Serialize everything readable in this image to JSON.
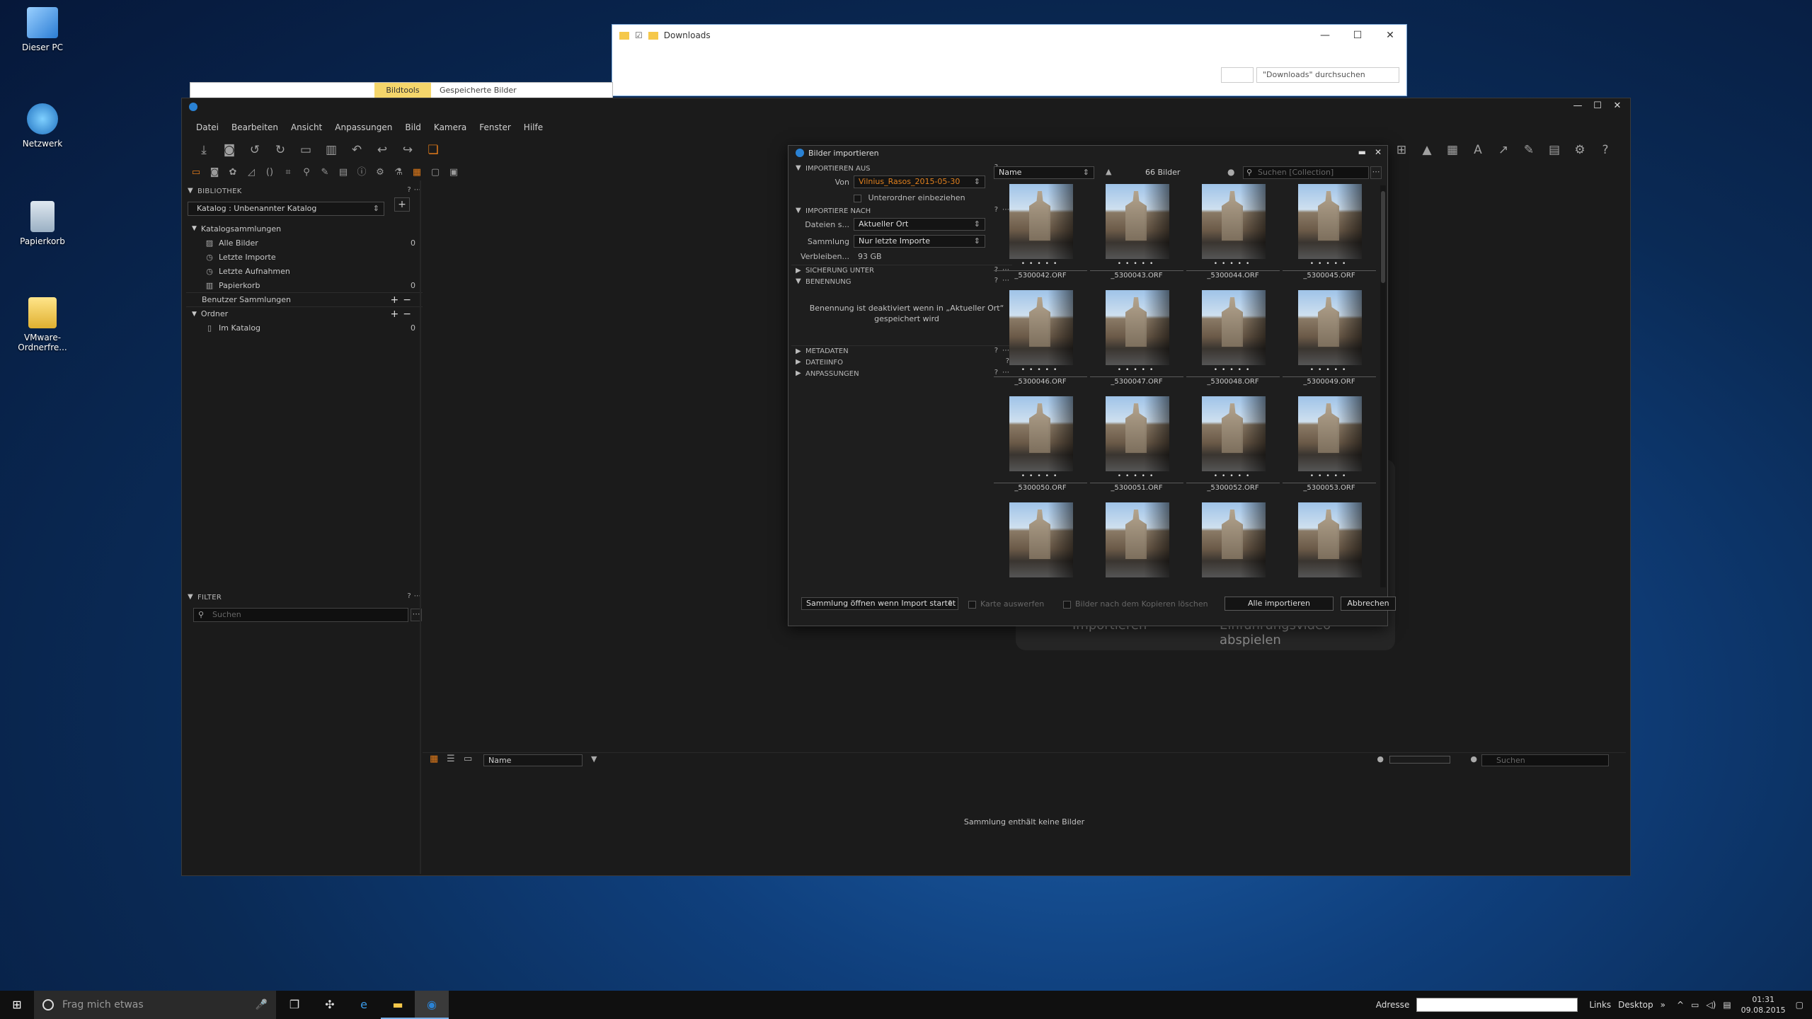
{
  "desktop": {
    "icons": [
      {
        "label": "Dieser PC"
      },
      {
        "label": "Netzwerk"
      },
      {
        "label": "Papierkorb"
      },
      {
        "label": "VMware-Ordnerfre..."
      }
    ]
  },
  "explorer": {
    "title": "Downloads",
    "search_placeholder": "\"Downloads\" durchsuchen",
    "ribbon_tab": "Bildtools",
    "ribbon_title": "Gespeicherte Bilder"
  },
  "app": {
    "menu": [
      "Datei",
      "Bearbeiten",
      "Ansicht",
      "Anpassungen",
      "Bild",
      "Kamera",
      "Fenster",
      "Hilfe"
    ],
    "library": {
      "header": "BIBLIOTHEK",
      "catalog": "Katalog : Unbenannter Katalog",
      "catalog_collections": "Katalogsammlungen",
      "items": [
        {
          "label": "Alle Bilder",
          "count": "0"
        },
        {
          "label": "Letzte Importe",
          "count": ""
        },
        {
          "label": "Letzte Aufnahmen",
          "count": ""
        },
        {
          "label": "Papierkorb",
          "count": "0"
        }
      ],
      "user_collections": "Benutzer Sammlungen",
      "folders": "Ordner",
      "in_catalog": {
        "label": "Im Katalog",
        "count": "0"
      }
    },
    "filter": {
      "header": "FILTER",
      "search_placeholder": "Suchen"
    },
    "browser": {
      "sort": "Name",
      "search_placeholder": "Suchen",
      "empty_message": "Sammlung enthält keine Bilder"
    },
    "welcome": {
      "import": "Importieren",
      "video": "Einführungsvideo abspielen"
    }
  },
  "dialog": {
    "title": "Bilder importieren",
    "sections": {
      "import_from": "IMPORTIEREN AUS",
      "import_to": "IMPORTIERE NACH",
      "backup": "SICHERUNG UNTER",
      "naming": "BENENNUNG",
      "metadata": "METADATEN",
      "fileinfo": "DATEIINFO",
      "adjustments": "ANPASSUNGEN"
    },
    "from_label": "Von",
    "from_value": "Vilnius_Rasos_2015-05-30",
    "subfolders": "Unterordner einbeziehen",
    "files_label": "Dateien s...",
    "files_value": "Aktueller Ort",
    "collection_label": "Sammlung",
    "collection_value": "Nur letzte Importe",
    "remaining_label": "Verbleiben...",
    "remaining_value": "93 GB",
    "naming_msg_1": "Benennung ist deaktiviert wenn in „Aktueller Ort“",
    "naming_msg_2": "gespeichert wird",
    "sort": "Name",
    "image_count": "66 Bilder",
    "search_placeholder": "Suchen [Collection]",
    "thumbnails": [
      "_5300042.ORF",
      "_5300043.ORF",
      "_5300044.ORF",
      "_5300045.ORF",
      "_5300046.ORF",
      "_5300047.ORF",
      "_5300048.ORF",
      "_5300049.ORF",
      "_5300050.ORF",
      "_5300051.ORF",
      "_5300052.ORF",
      "_5300053.ORF",
      "",
      "",
      "",
      ""
    ],
    "footer": {
      "open_collection": "Sammlung öffnen wenn Import startet",
      "eject_card": "Karte auswerfen",
      "delete_after": "Bilder nach dem Kopieren löschen",
      "import_all": "Alle importieren",
      "cancel": "Abbrechen"
    }
  },
  "taskbar": {
    "search": "Frag mich etwas",
    "address_label": "Adresse",
    "links": "Links",
    "desktop": "Desktop",
    "time": "01:31",
    "date": "09.08.2015"
  }
}
